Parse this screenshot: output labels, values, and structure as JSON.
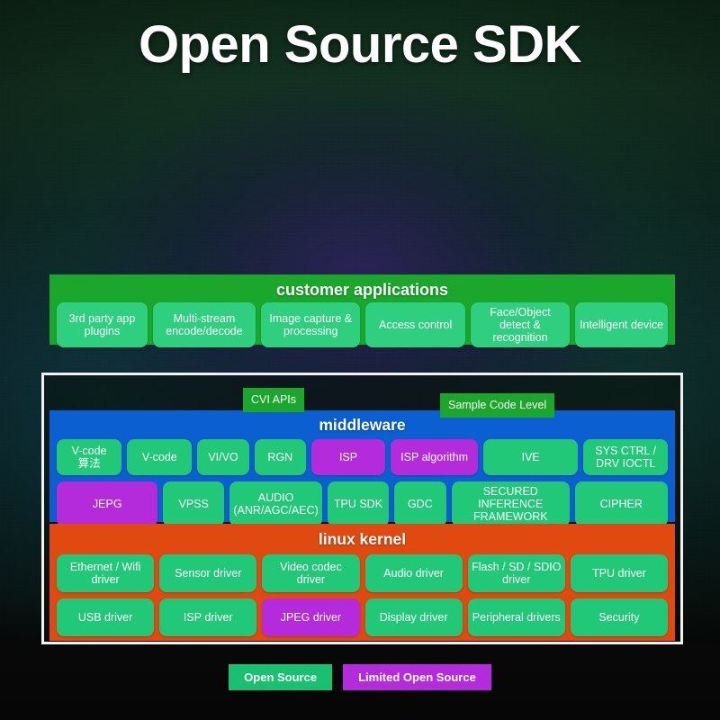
{
  "page": {
    "title": "Open Source SDK"
  },
  "colors": {
    "open_source_green": "#21c878",
    "limited_open_source_purple": "#b32bdb",
    "apps_panel_green": "#1aa72b",
    "middleware_blue": "#0b5fd0",
    "kernel_orange": "#e0490f",
    "frame_border": "#f2f2f2",
    "text_white": "#ffffff"
  },
  "apps": {
    "title": "customer applications",
    "items": [
      {
        "label": "3rd party app plugins",
        "type": "open",
        "flex": 1.0
      },
      {
        "label": "Multi-stream encode/decode",
        "type": "open",
        "flex": 1.14
      },
      {
        "label": "Image capture & processing",
        "type": "open",
        "flex": 1.1
      },
      {
        "label": "Access control",
        "type": "open",
        "flex": 1.1
      },
      {
        "label": "Face/Object detect & recognition",
        "type": "open",
        "flex": 1.1
      },
      {
        "label": "Intelligent device",
        "type": "open",
        "flex": 1.02
      }
    ]
  },
  "tags": {
    "cvi_apis": "CVI APIs",
    "sample_code_level": "Sample Code Level"
  },
  "middleware": {
    "title": "middleware",
    "row1": [
      {
        "label": "V-code",
        "label_cn": "算法",
        "type": "open",
        "flex": 0.8
      },
      {
        "label": "V-code",
        "type": "open",
        "flex": 0.8
      },
      {
        "label": "VI/VO",
        "type": "open",
        "flex": 0.62
      },
      {
        "label": "RGN",
        "type": "open",
        "flex": 0.62
      },
      {
        "label": "ISP",
        "type": "limited",
        "flex": 0.92
      },
      {
        "label": "ISP algorithm",
        "type": "limited",
        "flex": 1.1
      },
      {
        "label": "IVE",
        "type": "open",
        "flex": 1.2
      },
      {
        "label": "SYS CTRL / DRV IOCTL",
        "type": "open",
        "flex": 1.06
      }
    ],
    "row2": [
      {
        "label": "JEPG",
        "type": "limited",
        "flex": 1.18
      },
      {
        "label": "VPSS",
        "type": "open",
        "flex": 0.68
      },
      {
        "label": "AUDIO (ANR/AGC/AEC)",
        "type": "open",
        "flex": 1.08
      },
      {
        "label": "TPU SDK",
        "type": "open",
        "flex": 0.68
      },
      {
        "label": "GDC",
        "type": "open",
        "flex": 0.58
      },
      {
        "label": "SECURED INFERENCE FRAMEWORK",
        "type": "open",
        "flex": 1.38
      },
      {
        "label": "CIPHER",
        "type": "open",
        "flex": 1.08
      }
    ]
  },
  "kernel": {
    "title": "linux kernel",
    "row1": [
      {
        "label": "Ethernet / Wifi driver",
        "type": "open",
        "flex": 1.0
      },
      {
        "label": "Sensor driver",
        "type": "open",
        "flex": 1.0
      },
      {
        "label": "Video codec driver",
        "type": "open",
        "flex": 1.0
      },
      {
        "label": "Audio driver",
        "type": "open",
        "flex": 1.0
      },
      {
        "label": "Flash / SD / SDIO driver",
        "type": "open",
        "flex": 1.0
      },
      {
        "label": "TPU driver",
        "type": "open",
        "flex": 1.0
      }
    ],
    "row2": [
      {
        "label": "USB driver",
        "type": "open",
        "flex": 1.0
      },
      {
        "label": "ISP driver",
        "type": "open",
        "flex": 1.0
      },
      {
        "label": "JPEG driver",
        "type": "limited",
        "flex": 1.0
      },
      {
        "label": "Display driver",
        "type": "open",
        "flex": 1.0
      },
      {
        "label": "Peripheral drivers",
        "type": "open",
        "flex": 1.0
      },
      {
        "label": "Security",
        "type": "open",
        "flex": 1.0
      }
    ]
  },
  "legend": [
    {
      "label": "Open Source",
      "type": "open"
    },
    {
      "label": "Limited Open Source",
      "type": "limited"
    }
  ]
}
